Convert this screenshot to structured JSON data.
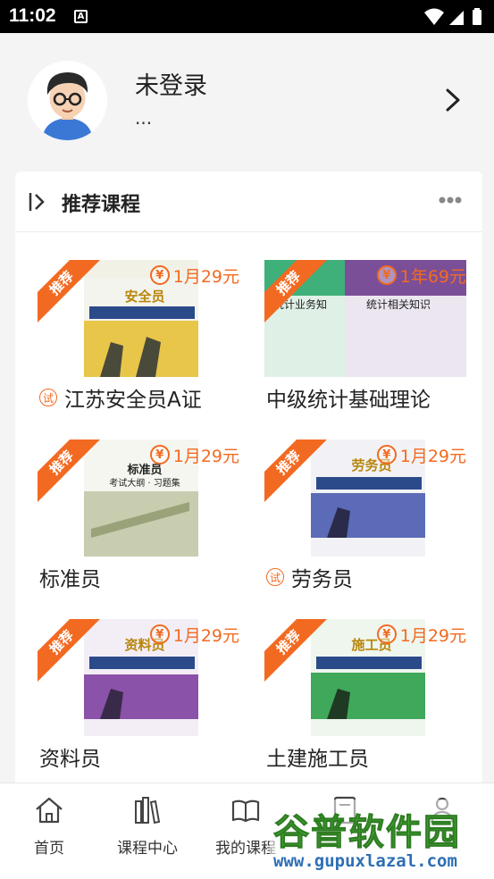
{
  "status_bar": {
    "time": "11:02",
    "notification_icon": "A"
  },
  "profile": {
    "name": "未登录",
    "subtitle": "..."
  },
  "section": {
    "title": "推荐课程"
  },
  "courses": [
    {
      "title": "江苏安全员A证",
      "price": "1月29元",
      "tag": "推荐",
      "trial": true,
      "trial_badge": "试",
      "cover_text": "安全员"
    },
    {
      "title": "中级统计基础理论",
      "price": "1年69元",
      "tag": "推荐",
      "trial": false,
      "cover_text": "统计相关知识"
    },
    {
      "title": "标准员",
      "price": "1月29元",
      "tag": "推荐",
      "trial": false,
      "cover_text": "标准员"
    },
    {
      "title": "劳务员",
      "price": "1月29元",
      "tag": "推荐",
      "trial": true,
      "trial_badge": "试",
      "cover_text": "劳务员"
    },
    {
      "title": "资料员",
      "price": "1月29元",
      "tag": "推荐",
      "trial": false,
      "cover_text": "资料员"
    },
    {
      "title": "土建施工员",
      "price": "1月29元",
      "tag": "推荐",
      "trial": false,
      "cover_text": "施工员"
    }
  ],
  "tabs": [
    {
      "label": "首页",
      "icon": "home-icon"
    },
    {
      "label": "课程中心",
      "icon": "books-icon"
    },
    {
      "label": "我的课程",
      "icon": "open-book-icon"
    },
    {
      "label": "",
      "icon": "notebook-icon"
    },
    {
      "label": "",
      "icon": "user-icon"
    }
  ],
  "watermark": {
    "line1": "谷普软件园",
    "line2": "www.gupuxlazal.com"
  },
  "colors": {
    "accent": "#f26a21",
    "background": "#f4f4f4",
    "card": "#ffffff"
  }
}
